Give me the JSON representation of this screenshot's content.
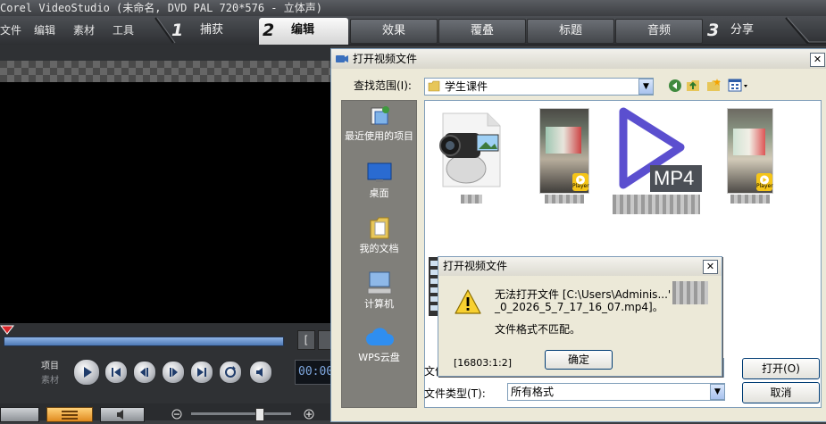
{
  "app": {
    "title": "Corel VideoStudio (未命名, DVD PAL 720*576 - 立体声)"
  },
  "menu": {
    "items": [
      "文件",
      "编辑",
      "素材",
      "工具"
    ],
    "steps": [
      {
        "num": "1",
        "label": "捕获"
      },
      {
        "num": "2",
        "label": "编辑"
      },
      {
        "num": "3",
        "label": "分享"
      }
    ],
    "tabs": [
      "效果",
      "覆叠",
      "标题",
      "音频"
    ]
  },
  "player": {
    "mode_project": "项目",
    "mode_clip": "素材",
    "timecode": "00:00"
  },
  "open_dialog": {
    "title": "打开视频文件",
    "lookin_label": "查找范围(I):",
    "lookin_value": "学生课件",
    "places": [
      "最近使用的项目",
      "桌面",
      "我的文档",
      "计算机",
      "WPS云盘"
    ],
    "filename_label": "文件",
    "filetype_label": "文件类型(T):",
    "filetype_value": "所有格式",
    "open_button": "打开(O)",
    "cancel_button": "取消",
    "mp4_badge": "MP4",
    "player_badge": "Player"
  },
  "error_dialog": {
    "title": "打开视频文件",
    "message_line1": "无法打开文件 [C:\\Users\\Adminis...'",
    "message_line2": "_0_2026_5_7_17_16_07.mp4]。",
    "message_line3": "文件格式不匹配。",
    "code": "[16803:1:2]",
    "ok_button": "确定"
  },
  "colors": {
    "mp4_play": "#5b4fcf",
    "wps_cloud": "#2f8ef0",
    "badge": "#f5c518"
  }
}
